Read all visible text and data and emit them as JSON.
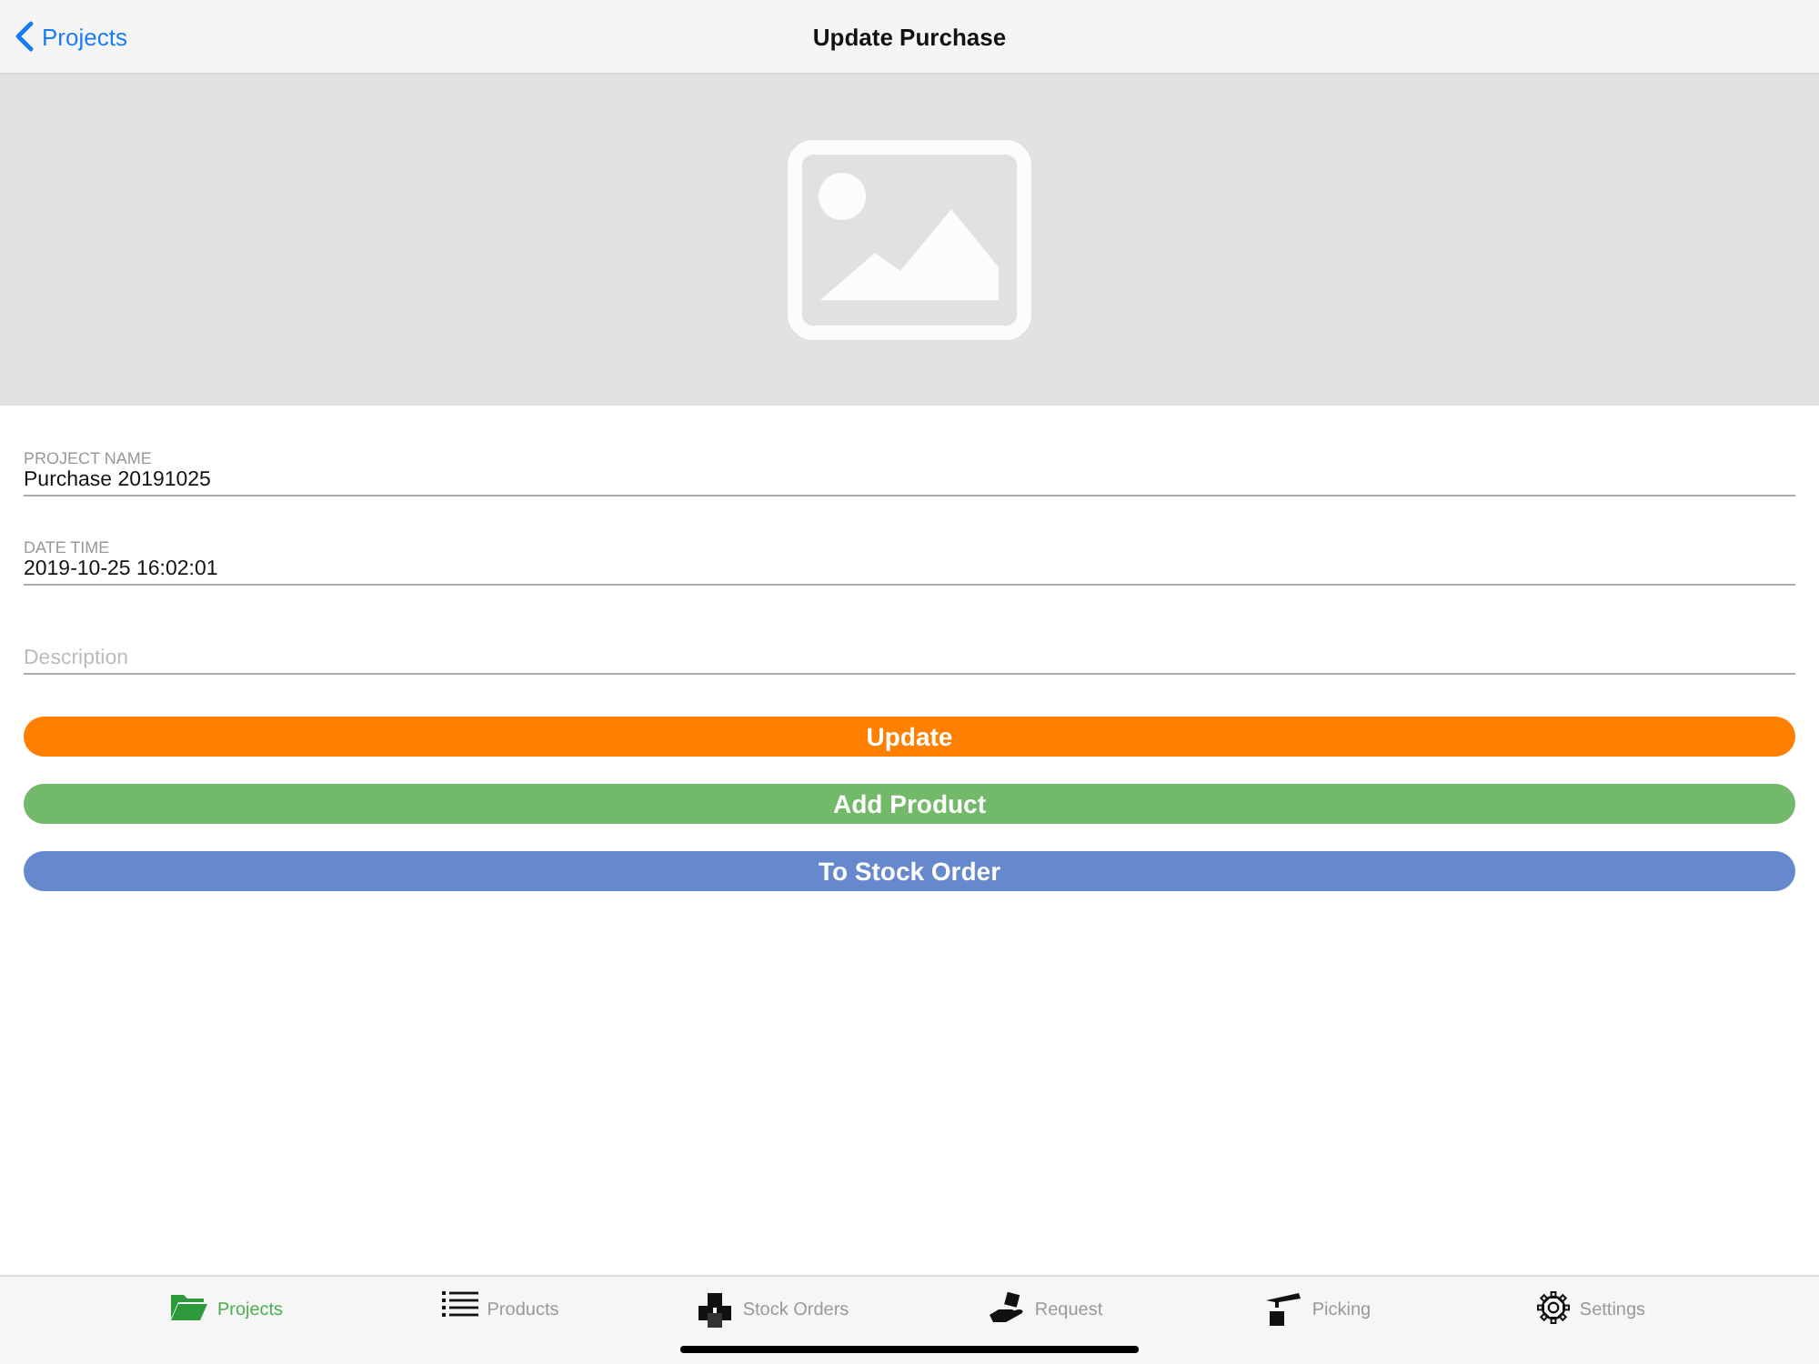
{
  "nav_bar": {
    "back_label": "Projects",
    "title": "Update Purchase"
  },
  "fields": [
    {
      "label": "PROJECT NAME",
      "value": "Purchase 20191025"
    },
    {
      "label": "DATE TIME",
      "value": "2019-10-25 16:02:01"
    },
    {
      "placeholder": "Description"
    }
  ],
  "buttons": [
    {
      "label": "Update",
      "color": "#ff8000"
    },
    {
      "label": "Add Product",
      "color": "#72b96a"
    },
    {
      "label": "To Stock Order",
      "color": "#6688cc"
    }
  ],
  "tab_bar": [
    {
      "label": "Projects",
      "selected": true
    },
    {
      "label": "Products",
      "selected": false
    },
    {
      "label": "Stock Orders",
      "selected": false
    },
    {
      "label": "Request",
      "selected": false
    },
    {
      "label": "Picking",
      "selected": false
    },
    {
      "label": "Settings",
      "selected": false
    }
  ]
}
